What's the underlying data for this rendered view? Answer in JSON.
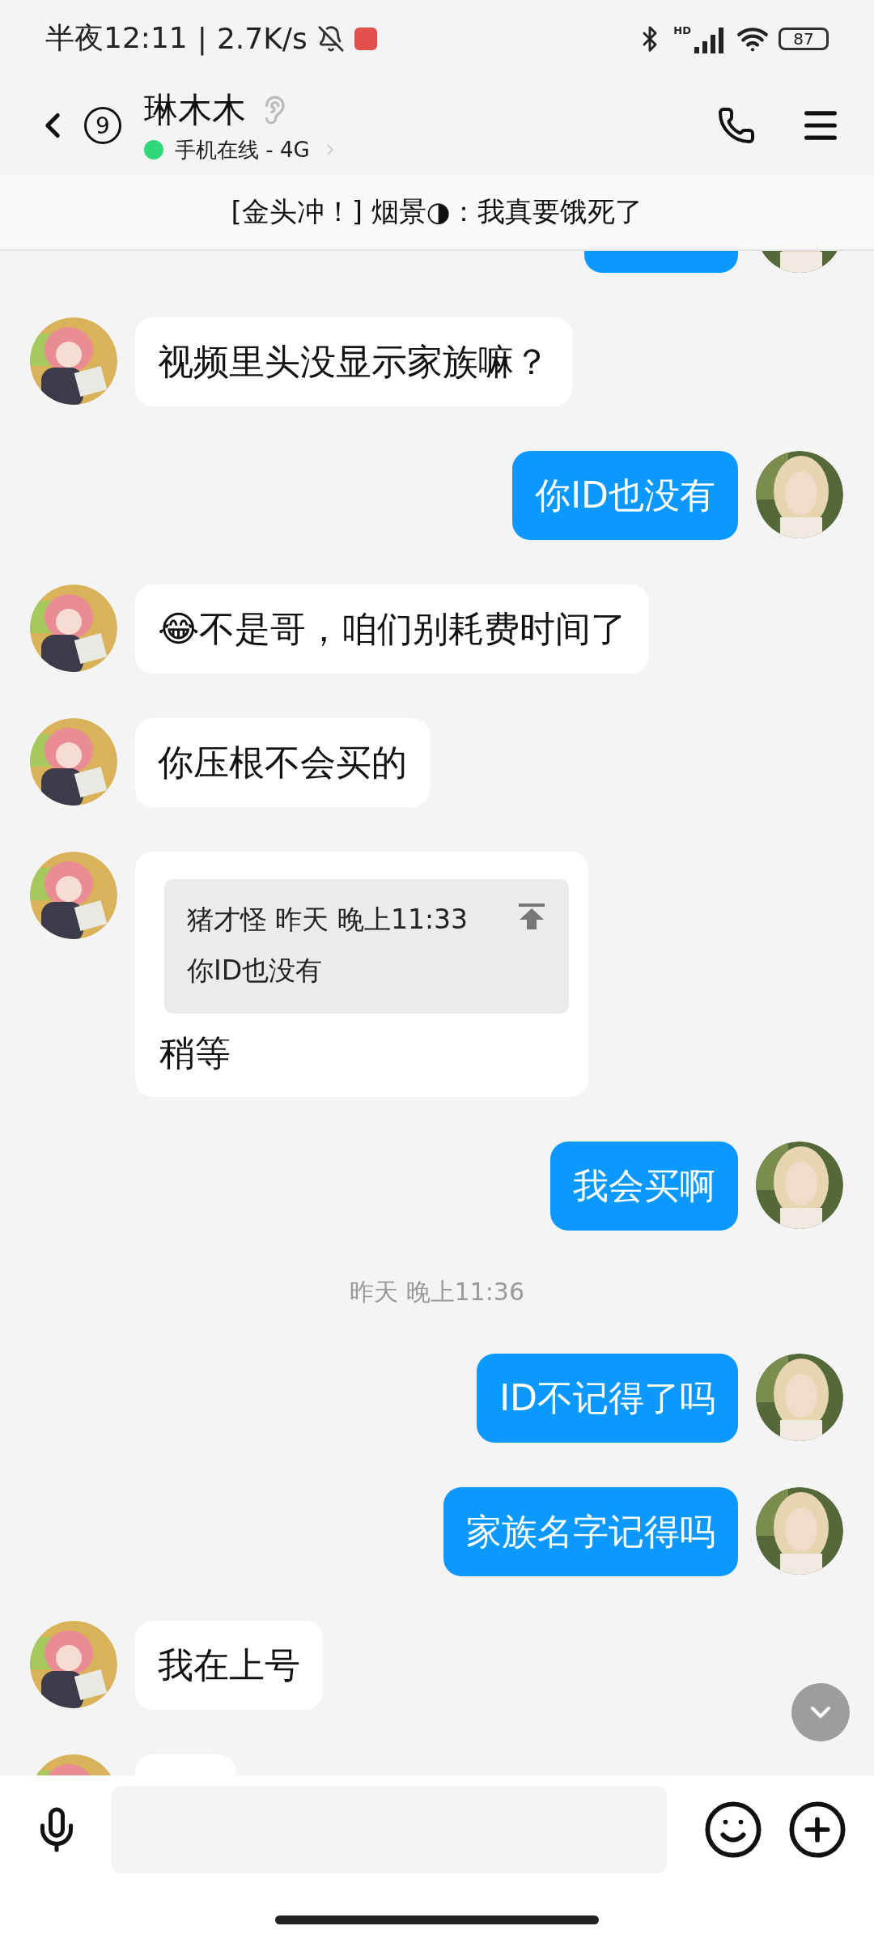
{
  "status_bar": {
    "time": "半夜12:11",
    "separator": "|",
    "speed": "2.7K/s",
    "signal_label": "HD",
    "battery": "87"
  },
  "header": {
    "back_badge": "9",
    "name": "琳木木",
    "presence": "手机在线 - 4G"
  },
  "pinned_banner": {
    "text": "[金头冲！] 烟景◑：我真要饿死了"
  },
  "messages": [
    {
      "kind": "tail",
      "outgoing": true
    },
    {
      "kind": "text",
      "outgoing": false,
      "text": "视频里头没显示家族嘛？"
    },
    {
      "kind": "text",
      "outgoing": true,
      "text": "你ID也没有"
    },
    {
      "kind": "text",
      "outgoing": false,
      "text": "😂不是哥，咱们别耗费时间了"
    },
    {
      "kind": "text",
      "outgoing": false,
      "text": "你压根不会买的"
    },
    {
      "kind": "quote",
      "outgoing": false,
      "quote_meta": "猪才怪 昨天 晚上11:33",
      "quote_text": "你ID也没有",
      "text": "稍等"
    },
    {
      "kind": "text",
      "outgoing": true,
      "text": "我会买啊"
    },
    {
      "kind": "time",
      "text": "昨天 晚上11:36"
    },
    {
      "kind": "text",
      "outgoing": true,
      "text": "ID不记得了吗"
    },
    {
      "kind": "text",
      "outgoing": true,
      "text": "家族名字记得吗"
    },
    {
      "kind": "text",
      "outgoing": false,
      "text": "我在上号"
    },
    {
      "kind": "partial",
      "outgoing": false
    }
  ]
}
